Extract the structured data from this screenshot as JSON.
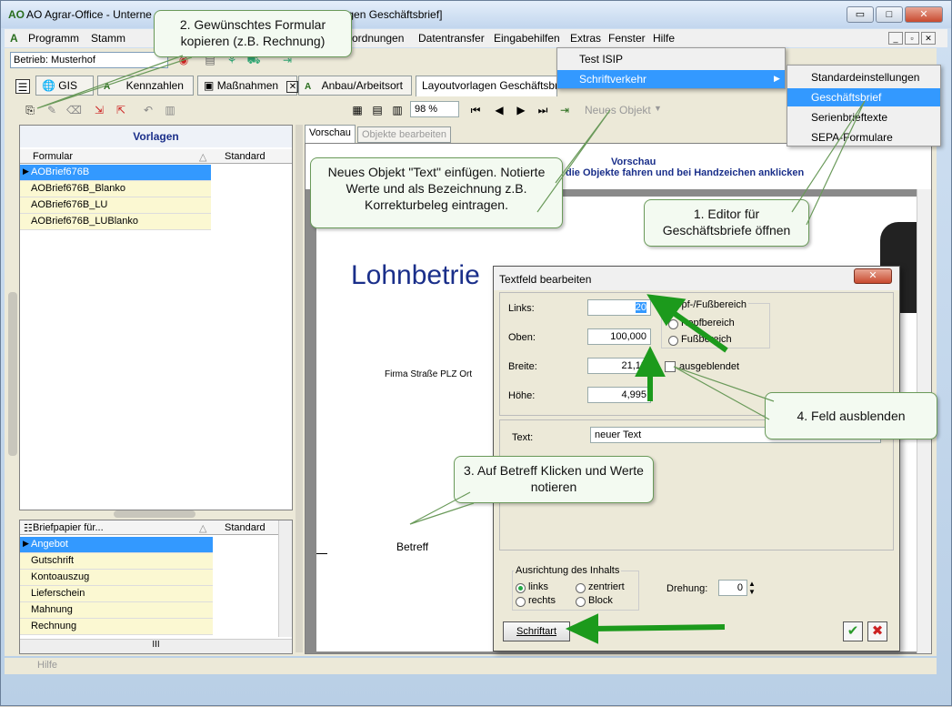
{
  "window": {
    "logo": "AO",
    "title_left": "AO Agrar-Office - Unterne",
    "title_right": "lagen Geschäftsbrief]",
    "min_label": "▭",
    "max_label": "□",
    "close_label": "✕"
  },
  "menubar": {
    "items": [
      "Programm",
      "Stamm",
      "rordnungen",
      "Datentransfer",
      "Eingabehilfen",
      "Extras",
      "Fenster",
      "Hilfe"
    ]
  },
  "betrieb": {
    "label": "Betrieb: Musterhof"
  },
  "tabs": [
    {
      "label": "GIS"
    },
    {
      "label": "Kennzahlen"
    },
    {
      "label": "Maßnahmen"
    },
    {
      "label": "Anbau/Arbeitsort"
    },
    {
      "label": "Layoutvorlagen Geschäftsbrief"
    }
  ],
  "toolbar2": {
    "zoom": "98 %",
    "new_object": "Neues Objekt"
  },
  "vorlagen": {
    "title": "Vorlagen",
    "col_formular": "Formular",
    "col_standard": "Standard",
    "rows": [
      "AOBrief676B",
      "AOBrief676B_Blanko",
      "AOBrief676B_LU",
      "AOBrief676B_LUBlanko"
    ]
  },
  "briefpapier": {
    "col_name": "Briefpapier für...",
    "col_standard": "Standard",
    "rows": [
      "Angebot",
      "Gutschrift",
      "Kontoauszug",
      "Lieferschein",
      "Mahnung",
      "Rechnung"
    ],
    "scroll_label": "III"
  },
  "preview": {
    "tab_vorschau": "Vorschau",
    "tab_objekte": "Objekte bearbeiten",
    "header_title": "Vorschau",
    "header_sub": "die Objekte fahren und bei Handzeichen anklicken",
    "big_title": "Lohnbetrie",
    "address": "Firma Straße PLZ Ort",
    "betreff": "Betreff"
  },
  "extras_menu": {
    "items": [
      "Test ISIP",
      "Schriftverkehr"
    ]
  },
  "submenu": {
    "items": [
      "Standardeinstellungen",
      "Geschäftsbrief",
      "Serienbrieftexte",
      "SEPA-Formulare"
    ]
  },
  "dialog": {
    "title": "Textfeld bearbeiten",
    "links_label": "Links:",
    "links_value": "20",
    "oben_label": "Oben:",
    "oben_value": "100,000",
    "breite_label": "Breite:",
    "breite_value": "21,18",
    "hoehe_label": "Höhe:",
    "hoehe_value": "4,995",
    "bereich_title": "Kopf-/Fußbereich",
    "kopf_label": "Kopfbereich",
    "fuss_label": "Fußbereich",
    "ausgeblendet_label": "ausgeblendet",
    "text_label": "Text:",
    "text_value": "neuer Text",
    "ausrichtung_title": "Ausrichtung des Inhalts",
    "links_radio": "links",
    "zentriert_radio": "zentriert",
    "rechts_radio": "rechts",
    "block_radio": "Block",
    "drehung_label": "Drehung:",
    "drehung_value": "0",
    "schriftart_label": "Schriftart",
    "ok_label": "✔",
    "cancel_label": "✖"
  },
  "callouts": {
    "c2": "2. Gewünschtes Formular kopieren (z.B. Rechnung)",
    "neues": "Neues Objekt \"Text\" einfügen. Notierte Werte und als Bezeichnung z.B. Korrekturbeleg eintragen.",
    "c1": "1. Editor für Geschäftsbriefe öffnen",
    "c3": "3. Auf Betreff Klicken und Werte notieren",
    "c4": "4. Feld ausblenden"
  },
  "statusbar": {
    "text": "Hilfe"
  },
  "colors": {
    "arrow": "#1c9a1c",
    "highlight": "#3399ff",
    "bubble_border": "#6a9a5a"
  }
}
